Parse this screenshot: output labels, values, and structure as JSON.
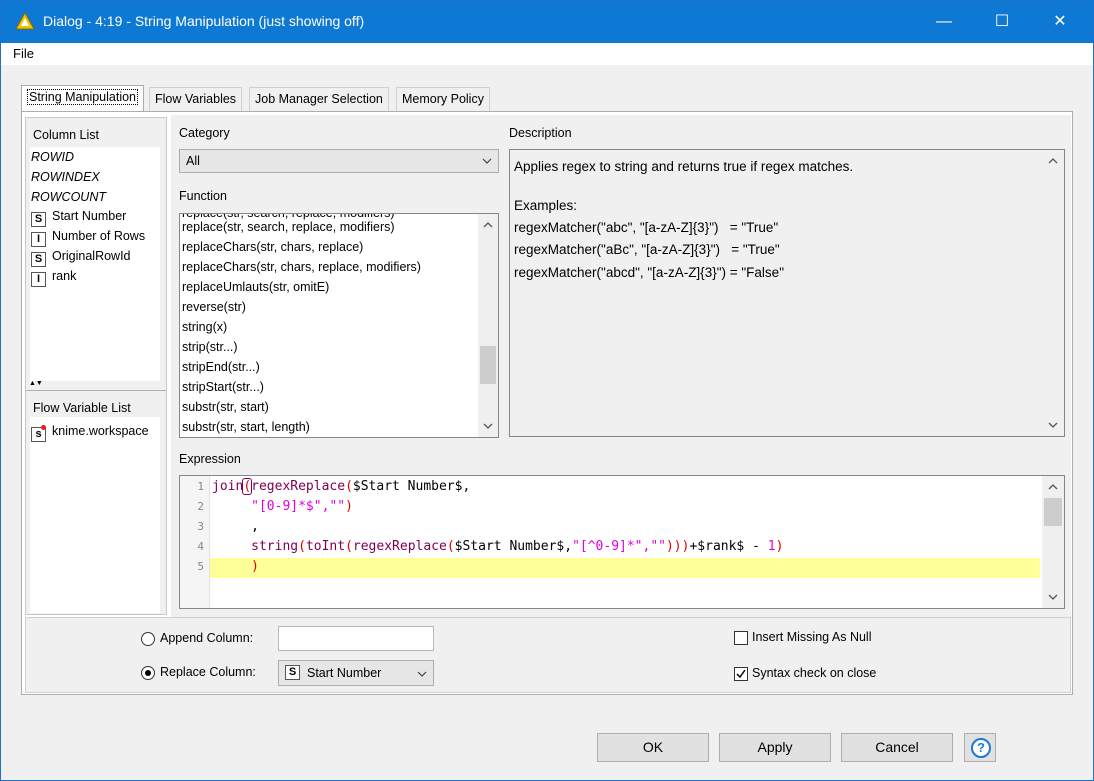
{
  "window": {
    "title": "Dialog - 4:19 - String Manipulation (just showing off)",
    "minimize": "—",
    "maximize": "☐",
    "close": "✕"
  },
  "menu": {
    "file": "File"
  },
  "tabs": [
    {
      "label": "String Manipulation",
      "active": true
    },
    {
      "label": "Flow Variables"
    },
    {
      "label": "Job Manager Selection"
    },
    {
      "label": "Memory Policy"
    }
  ],
  "column_list": {
    "title": "Column List",
    "special": [
      "ROWID",
      "ROWINDEX",
      "ROWCOUNT"
    ],
    "columns": [
      {
        "type": "S",
        "name": "Start Number"
      },
      {
        "type": "I",
        "name": "Number of Rows"
      },
      {
        "type": "S",
        "name": "OriginalRowId"
      },
      {
        "type": "I",
        "name": "rank"
      }
    ]
  },
  "flow_variable_list": {
    "title": "Flow Variable List",
    "items": [
      {
        "type": "s",
        "name": "knime.workspace"
      }
    ]
  },
  "category": {
    "label": "Category",
    "value": "All"
  },
  "function": {
    "label": "Function",
    "items": [
      "replace(str, search, replace, modifiers)",
      "replaceChars(str, chars, replace)",
      "replaceChars(str, chars, replace, modifiers)",
      "replaceUmlauts(str, omitE)",
      "reverse(str)",
      "string(x)",
      "strip(str...)",
      "stripEnd(str...)",
      "stripStart(str...)",
      "substr(str, start)",
      "substr(str, start, length)"
    ]
  },
  "description": {
    "label": "Description",
    "summary": "Applies regex to string and returns true if regex matches.",
    "examples_label": "Examples:",
    "examples": [
      "regexMatcher(\"abc\", \"[a-zA-Z]{3}\")   = \"True\"",
      "regexMatcher(\"aBc\", \"[a-zA-Z]{3}\")   = \"True\"",
      "regexMatcher(\"abcd\", \"[a-zA-Z]{3}\") = \"False\""
    ]
  },
  "expression": {
    "label": "Expression",
    "line_numbers": [
      "1",
      "2",
      "3",
      "4",
      "5"
    ],
    "l1_fn1": "join",
    "l1_paren": "(",
    "l1_fn2": "regexReplace",
    "l1_paren2": "(",
    "l1_col": "$Start Number$,",
    "l2_str": "\"[0-9]*$\",\"\"",
    "l2_paren": ")",
    "l3_text": ",",
    "l4_fn1": "string",
    "l4_fn2": "toInt",
    "l4_fn3": "regexReplace",
    "l4_col": "$Start Number$,",
    "l4_str": "\"[^0-9]*\",\"\"",
    "l4_close": "))",
    "l4_rest": "+$rank$ - ",
    "l4_num": "1",
    "l4_end": ")",
    "l5_paren": ")"
  },
  "options": {
    "append_label": "Append Column:",
    "replace_label": "Replace Column:",
    "replace_value": {
      "type": "S",
      "name": "Start Number"
    },
    "insert_missing_label": "Insert Missing As Null",
    "syntax_check_label": "Syntax check on close",
    "append_selected": false,
    "replace_selected": true,
    "insert_missing_checked": false,
    "syntax_check_checked": true
  },
  "buttons": {
    "ok": "OK",
    "apply": "Apply",
    "cancel": "Cancel",
    "help": "?"
  }
}
